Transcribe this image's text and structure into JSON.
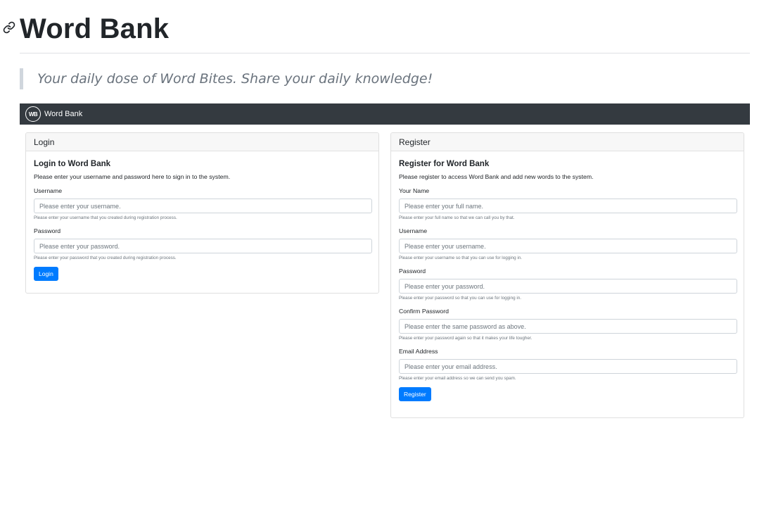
{
  "header": {
    "title": "Word Bank",
    "tagline": "Your daily dose of Word Bites. Share your daily knowledge!"
  },
  "navbar": {
    "brand_logo_text": "WB",
    "brand_text": "Word Bank"
  },
  "login": {
    "header": "Login",
    "title": "Login to Word Bank",
    "text": "Please enter your username and password here to sign in to the system.",
    "username_label": "Username",
    "username_placeholder": "Please enter your username.",
    "username_help": "Please enter your username that you created during registration process.",
    "password_label": "Password",
    "password_placeholder": "Please enter your password.",
    "password_help": "Please enter your password that you created during registration process.",
    "button": "Login"
  },
  "register": {
    "header": "Register",
    "title": "Register for Word Bank",
    "text": "Please register to access Word Bank and add new words to the system.",
    "name_label": "Your Name",
    "name_placeholder": "Please enter your full name.",
    "name_help": "Please enter your full name so that we can call you by that.",
    "username_label": "Username",
    "username_placeholder": "Please enter your username.",
    "username_help": "Please enter your username so that you can use for logging in.",
    "password_label": "Password",
    "password_placeholder": "Please enter your password.",
    "password_help": "Please enter your password so that you can use for logging in.",
    "confirm_label": "Confirm Password",
    "confirm_placeholder": "Please enter the same password as above.",
    "confirm_help": "Please enter your password again so that it makes your life tougher.",
    "email_label": "Email Address",
    "email_placeholder": "Please enter your email address.",
    "email_help": "Please enter your email address so we can send you spam.",
    "button": "Register"
  },
  "colors": {
    "navbar_bg": "#343a40",
    "primary": "#007bff",
    "quote_border": "#d0d6dd"
  }
}
